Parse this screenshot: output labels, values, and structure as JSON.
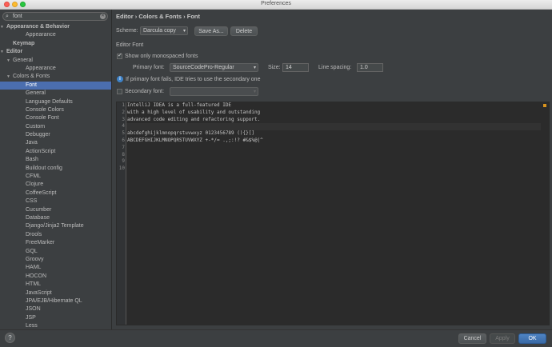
{
  "window": {
    "title": "Preferences"
  },
  "search": {
    "value": "font"
  },
  "tree": [
    {
      "label": "Appearance & Behavior",
      "level": 0,
      "arrow": "down",
      "bold": true
    },
    {
      "label": "Appearance",
      "level": 2
    },
    {
      "label": "Keymap",
      "level": 1,
      "bold": true
    },
    {
      "label": "Editor",
      "level": 0,
      "arrow": "down",
      "bold": true
    },
    {
      "label": "General",
      "level": 1,
      "arrow": "down"
    },
    {
      "label": "Appearance",
      "level": 2
    },
    {
      "label": "Colors & Fonts",
      "level": 1,
      "arrow": "down"
    },
    {
      "label": "Font",
      "level": 2,
      "selected": true
    },
    {
      "label": "General",
      "level": 2
    },
    {
      "label": "Language Defaults",
      "level": 2
    },
    {
      "label": "Console Colors",
      "level": 2
    },
    {
      "label": "Console Font",
      "level": 2
    },
    {
      "label": "Custom",
      "level": 2
    },
    {
      "label": "Debugger",
      "level": 2
    },
    {
      "label": "Java",
      "level": 2
    },
    {
      "label": "ActionScript",
      "level": 2
    },
    {
      "label": "Bash",
      "level": 2
    },
    {
      "label": "Buildout config",
      "level": 2
    },
    {
      "label": "CFML",
      "level": 2
    },
    {
      "label": "Clojure",
      "level": 2
    },
    {
      "label": "CoffeeScript",
      "level": 2
    },
    {
      "label": "CSS",
      "level": 2
    },
    {
      "label": "Cucumber",
      "level": 2
    },
    {
      "label": "Database",
      "level": 2
    },
    {
      "label": "Django/Jinja2 Template",
      "level": 2
    },
    {
      "label": "Drools",
      "level": 2
    },
    {
      "label": "FreeMarker",
      "level": 2
    },
    {
      "label": "GQL",
      "level": 2
    },
    {
      "label": "Groovy",
      "level": 2
    },
    {
      "label": "HAML",
      "level": 2
    },
    {
      "label": "HOCON",
      "level": 2
    },
    {
      "label": "HTML",
      "level": 2
    },
    {
      "label": "JavaScript",
      "level": 2
    },
    {
      "label": "JPA/EJB/Hibernate QL",
      "level": 2
    },
    {
      "label": "JSON",
      "level": 2
    },
    {
      "label": "JSP",
      "level": 2
    },
    {
      "label": "Less",
      "level": 2
    }
  ],
  "main": {
    "breadcrumb": "Editor › Colors & Fonts › Font",
    "scheme_label": "Scheme:",
    "scheme_value": "Darcula copy",
    "save_as": "Save As...",
    "delete": "Delete",
    "section_title": "Editor Font",
    "show_monospaced": "Show only monospaced fonts",
    "primary_font_label": "Primary font:",
    "primary_font_value": "SourceCodePro-Regular",
    "size_label": "Size:",
    "size_value": "14",
    "line_spacing_label": "Line spacing:",
    "line_spacing_value": "1.0",
    "info_text": "If primary font fails, IDE tries to use the secondary one",
    "secondary_font_label": "Secondary font:",
    "secondary_font_value": ""
  },
  "preview": {
    "lines": [
      {
        "num": "1",
        "text": "IntelliJ IDEA is a full-featured IDE"
      },
      {
        "num": "2",
        "text": "with a high level of usability and outstanding"
      },
      {
        "num": "3",
        "text": "advanced code editing and refactoring support."
      },
      {
        "num": "4",
        "text": ""
      },
      {
        "num": "5",
        "text": "abcdefghijklmnopqrstuvwxyz 0123456789 (){}[]"
      },
      {
        "num": "6",
        "text": "ABCDEFGHIJKLMNOPQRSTUVWXYZ +-*/= .,;:!? #&$%@|^"
      },
      {
        "num": "7",
        "text": ""
      },
      {
        "num": "8",
        "text": ""
      },
      {
        "num": "9",
        "text": ""
      },
      {
        "num": "10",
        "text": ""
      }
    ]
  },
  "footer": {
    "help": "?",
    "cancel": "Cancel",
    "apply": "Apply",
    "ok": "OK"
  },
  "colors": {
    "selection": "#4b6eaf",
    "accent": "#3a6aa6",
    "background": "#3c3f41",
    "editor_bg": "#2b2b2b"
  }
}
